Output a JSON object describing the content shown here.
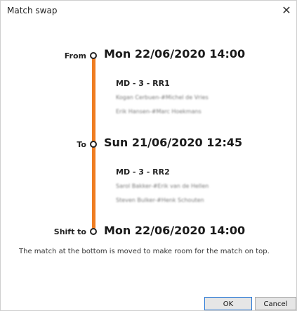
{
  "window": {
    "title": "Match swap",
    "close_glyph": "✕"
  },
  "timeline": {
    "from": {
      "label": "From",
      "datetime": "Mon 22/06/2020 14:00",
      "match_code": "MD - 3 - RR1",
      "line1": "Kogan Cerbuen-#Michel de Vries",
      "line2": "Erik Hansen-#Marc Hoekmans"
    },
    "to": {
      "label": "To",
      "datetime": "Sun 21/06/2020 12:45",
      "match_code": "MD - 3 - RR2",
      "line1": "Sarol Bakker-#Erik van de Hellen",
      "line2": "Steven Bulker-#Henk Schouten"
    },
    "shift_to": {
      "label": "Shift to",
      "datetime": "Mon 22/06/2020 14:00"
    },
    "colors": {
      "rail": "#ef7d22"
    }
  },
  "info_text": "The match at the bottom is moved to make room for the match on top.",
  "buttons": {
    "ok": "OK",
    "cancel": "Cancel"
  }
}
